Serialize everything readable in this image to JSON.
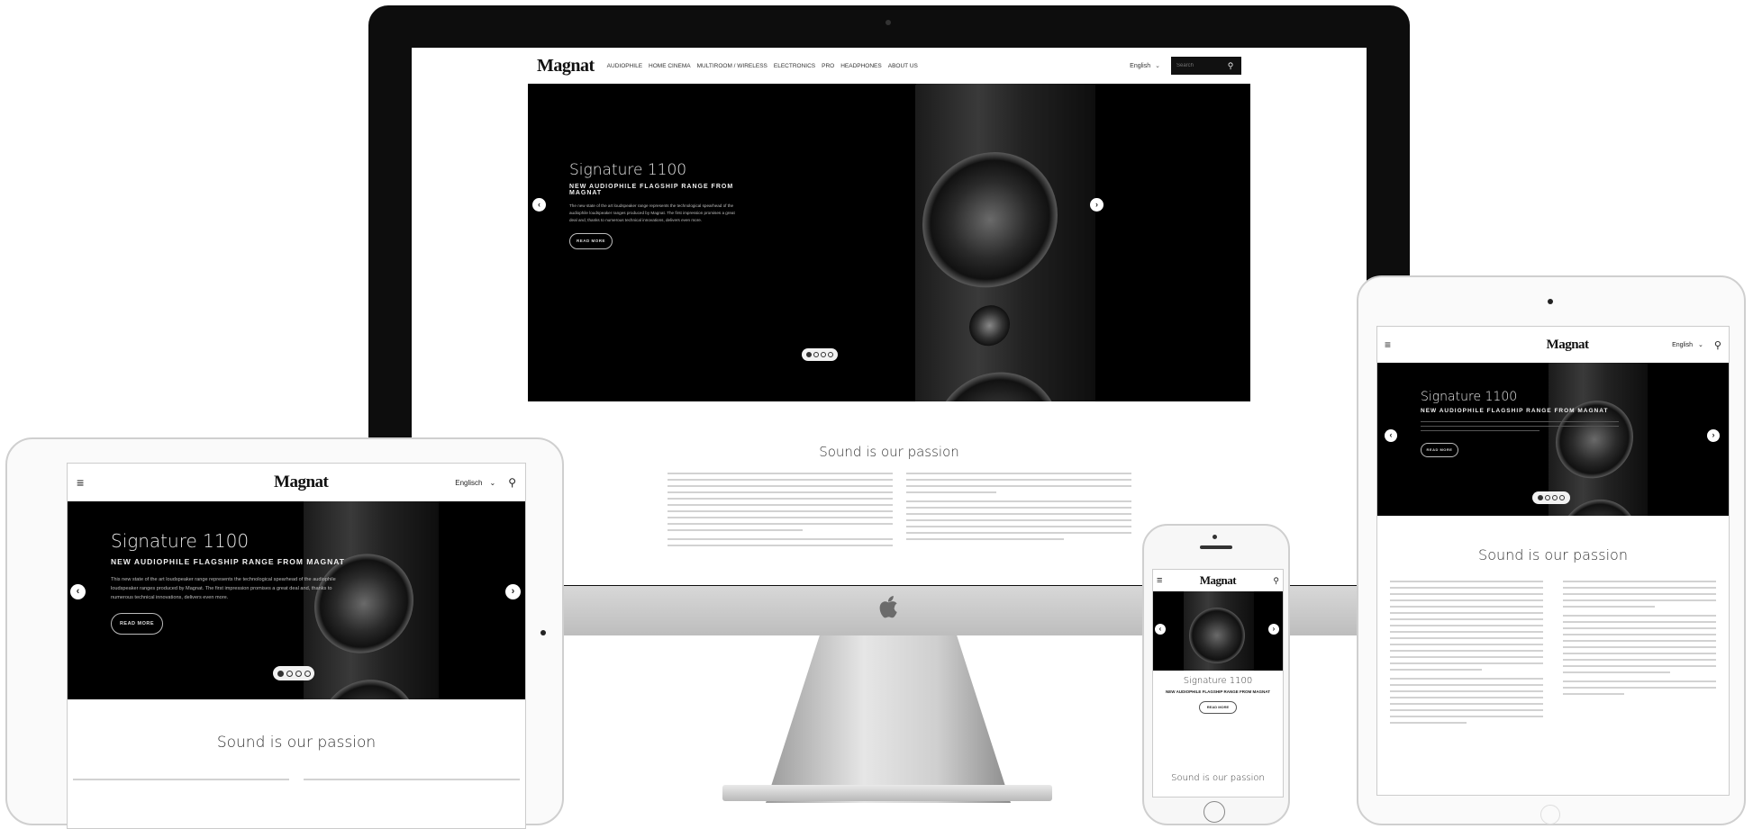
{
  "brand": "Magnat",
  "colors": {
    "hero_bg": "#000000",
    "device_frame": "#111111",
    "accent": "#ffffff"
  },
  "desktop": {
    "nav": {
      "items": [
        "AUDIOPHILE",
        "HOME CINEMA",
        "MULTIROOM / WIRELESS",
        "ELECTRONICS",
        "PRO",
        "HEADPHONES",
        "ABOUT US"
      ],
      "language": "English",
      "search_placeholder": "Search"
    },
    "hero": {
      "title": "Signature 1100",
      "subtitle": "NEW AUDIOPHILE FLAGSHIP RANGE FROM MAGNAT",
      "body": "The new state of the art loudspeaker range represents the technological spearhead of the audiophile loudspeaker ranges produced by Magnat. The first impression promises a great deal and, thanks to numerous technical innovations, delivers even more.",
      "button": "READ MORE"
    },
    "section_title": "Sound is our passion"
  },
  "tablet_left": {
    "language": "Englisch",
    "hero": {
      "title": "Signature 1100",
      "subtitle": "NEW AUDIOPHILE FLAGSHIP RANGE FROM MAGNAT",
      "body": "This new state of the art loudspeaker range represents the technological spearhead of the audiophile loudspeaker ranges produced by Magnat. The first impression promises a great deal and, thanks to numerous technical innovations, delivers even more.",
      "button": "READ MORE"
    },
    "section_title": "Sound is our passion"
  },
  "phone": {
    "hero": {
      "title": "Signature 1100",
      "subtitle": "NEW AUDIOPHILE FLAGSHIP RANGE FROM MAGNAT",
      "button": "READ MORE"
    },
    "section_title": "Sound is our passion"
  },
  "tablet_right": {
    "language": "English",
    "hero": {
      "title": "Signature 1100",
      "subtitle": "NEW AUDIOPHILE FLAGSHIP RANGE FROM MAGNAT",
      "button": "READ MORE"
    },
    "section_title": "Sound is our passion"
  },
  "icons": [
    "hamburger-icon",
    "search-icon",
    "chevron-left-icon",
    "chevron-right-icon",
    "chevron-down-icon",
    "apple-logo-icon"
  ]
}
